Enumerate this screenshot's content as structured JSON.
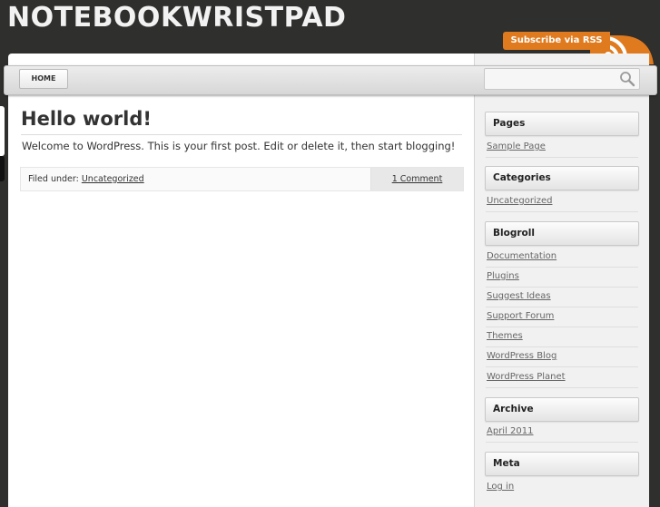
{
  "site": {
    "title": "NOTEBOOKWRISTPAD"
  },
  "rss": {
    "label": "Subscribe via RSS"
  },
  "nav": {
    "home_label": "HOME",
    "search_placeholder": ""
  },
  "post": {
    "title": "Hello world!",
    "body": "Welcome to WordPress. This is your first post. Edit or delete it, then start blogging!",
    "filed_label": "Filed under:",
    "category": "Uncategorized",
    "comments": "1 Comment"
  },
  "sidebar": {
    "pages": {
      "title": "Pages",
      "items": [
        "Sample Page"
      ]
    },
    "categories": {
      "title": "Categories",
      "items": [
        "Uncategorized"
      ]
    },
    "blogroll": {
      "title": "Blogroll",
      "items": [
        "Documentation",
        "Plugins",
        "Suggest Ideas",
        "Support Forum",
        "Themes",
        "WordPress Blog",
        "WordPress Planet"
      ]
    },
    "archive": {
      "title": "Archive",
      "items": [
        "April 2011"
      ]
    },
    "meta": {
      "title": "Meta",
      "items": [
        "Log in"
      ]
    }
  },
  "colors": {
    "background": "#2f2f2d",
    "rss_orange": "#e07a1e",
    "text": "#333333"
  }
}
